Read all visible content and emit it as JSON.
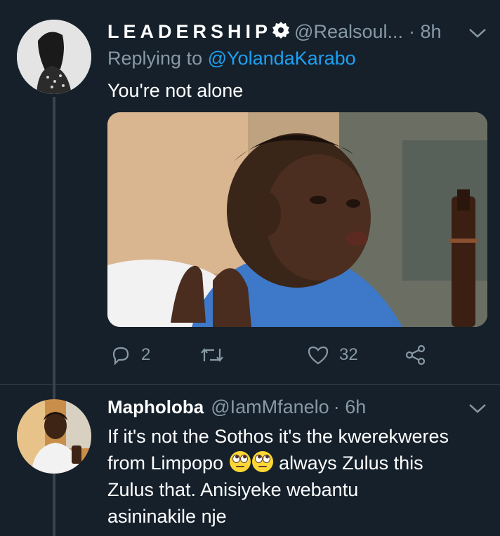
{
  "tweets": [
    {
      "display_name": "LEADERSHIP",
      "handle": "@Realsoul...",
      "time": "· 8h",
      "reply_prefix": "Replying to",
      "reply_handle": "@YolandaKarabo",
      "text": "You're not alone",
      "actions": {
        "reply_count": "2",
        "retweet_count": "",
        "like_count": "32"
      }
    },
    {
      "display_name": "Mapholoba",
      "handle": "@IamMfanelo",
      "time": "· 6h",
      "lines": [
        "If it's not the Sothos it's the kwerekweres",
        "from Limpopo",
        "always Zulus this",
        "Zulus that. Anisiyeke webantu",
        "asininakile nje"
      ],
      "emojis": [
        "face-with-rolling-eyes",
        "face-with-rolling-eyes"
      ]
    }
  ],
  "colors": {
    "background": "#15202b",
    "secondary_text": "#8899a6",
    "link": "#1da1f2",
    "divider": "#38444d"
  },
  "icons": [
    "reply-icon",
    "retweet-icon",
    "like-icon",
    "share-icon",
    "chevron-down-icon",
    "verified-badge-icon"
  ]
}
